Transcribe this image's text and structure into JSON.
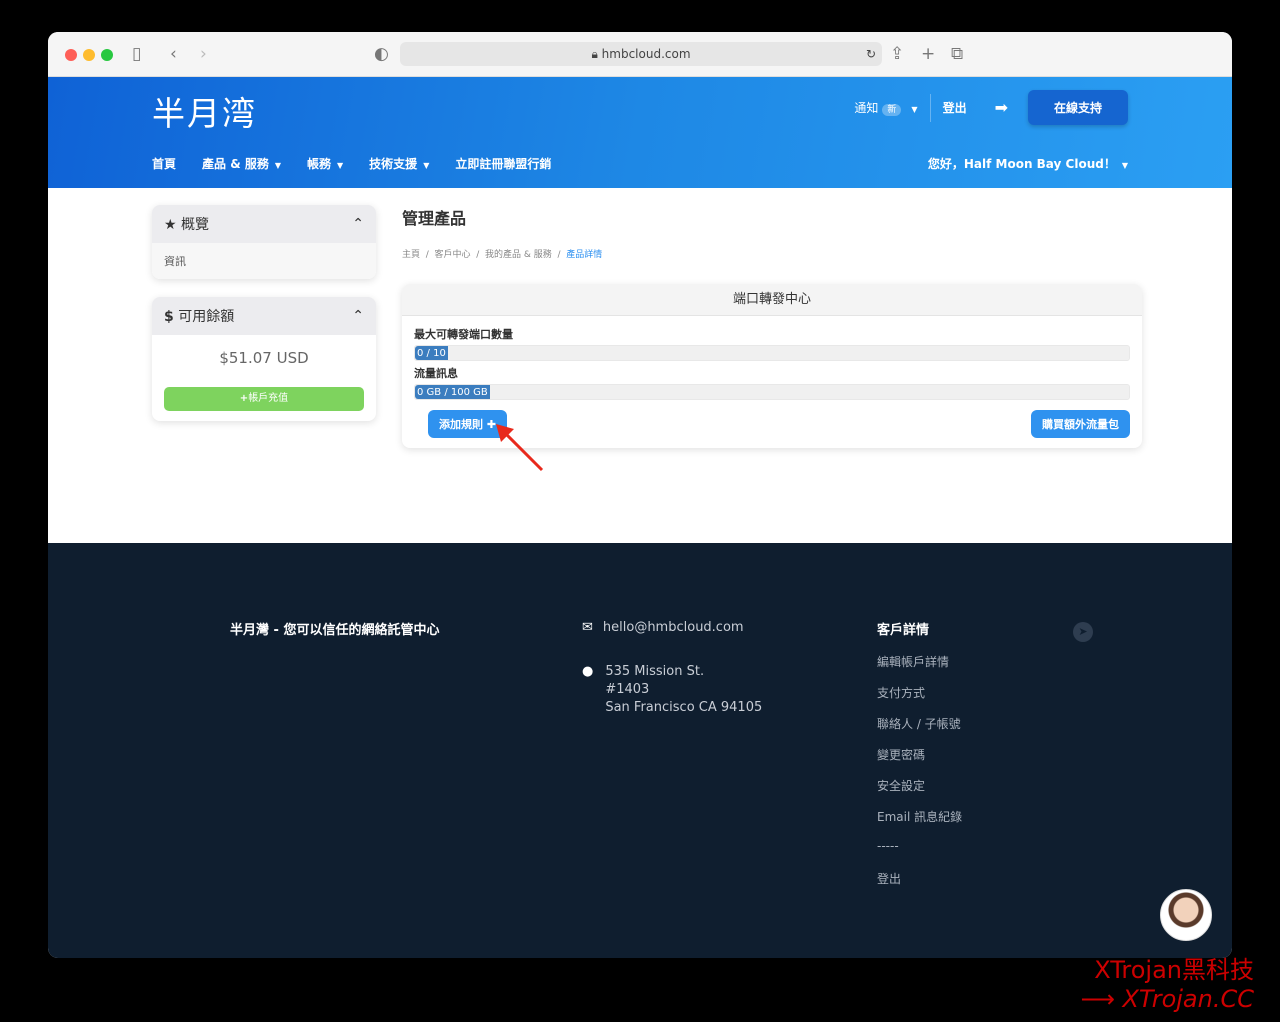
{
  "browser": {
    "url": "hmbcloud.com"
  },
  "header": {
    "logo": "半月湾",
    "notify": "通知",
    "notify_badge": "新",
    "logout": "登出",
    "support": "在線支持",
    "greeting": "您好，Half Moon Bay Cloud！",
    "nav": [
      "首頁",
      "產品 & 服務",
      "帳務",
      "技術支援",
      "立即註冊聯盟行銷"
    ]
  },
  "sidebar": {
    "overview": "概覽",
    "info": "資訊",
    "balance_title": "可用餘額",
    "balance": "$51.07 USD",
    "topup": "帳戶充值"
  },
  "main": {
    "title": "管理產品",
    "breadcrumb": [
      "主頁",
      "客戶中心",
      "我的產品 & 服務",
      "產品詳情"
    ],
    "card_title": "端口轉發中心",
    "ports_label": "最大可轉發端口數量",
    "ports_value": "0 / 10",
    "ports_used": 0,
    "ports_max": 10,
    "traffic_label": "流量訊息",
    "traffic_value": "0 GB / 100 GB",
    "traffic_used_gb": 0,
    "traffic_max_gb": 100,
    "add_rule": "添加規則",
    "buy_traffic": "購買額外流量包"
  },
  "footer": {
    "tagline": "半月灣 - 您可以信任的網絡託管中心",
    "email": "hello@hmbcloud.com",
    "address": [
      "535 Mission St.",
      "#1403",
      "San Francisco CA 94105"
    ],
    "links_title": "客戶詳情",
    "links": [
      "編輯帳戶詳情",
      "支付方式",
      "聯絡人 / 子帳號",
      "變更密碼",
      "安全設定",
      "Email 訊息紀錄",
      "-----",
      "登出"
    ]
  },
  "watermark": [
    "XTrojan黑科技",
    "⟶ XTrojan.CC"
  ]
}
